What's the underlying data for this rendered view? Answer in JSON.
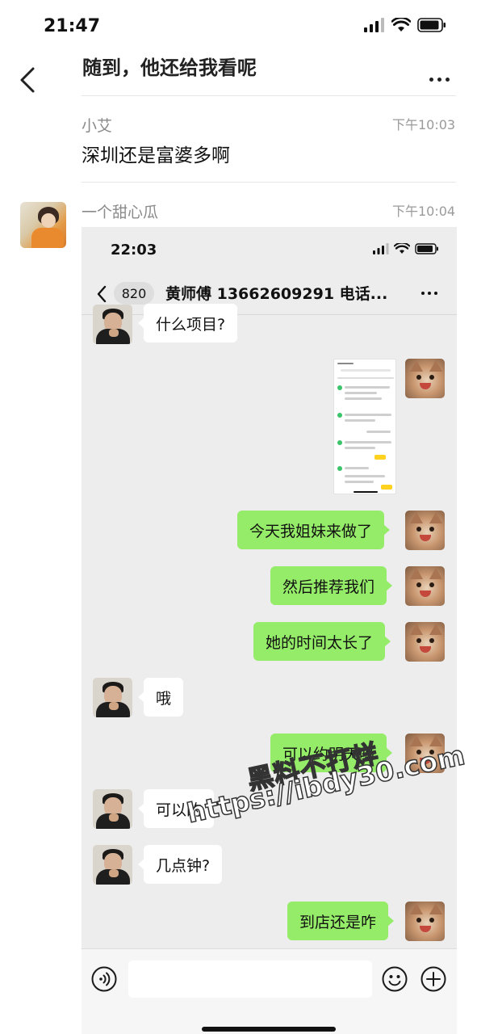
{
  "status_bar": {
    "time": "21:47"
  },
  "header": {
    "title": "随到，他还给我看呢"
  },
  "messages": [
    {
      "sender": "小艾",
      "time": "下午10:03",
      "text": "深圳还是富婆多啊"
    },
    {
      "sender": "一个甜心瓜",
      "time": "下午10:04"
    }
  ],
  "screenshot": {
    "status_time": "22:03",
    "unread_count": "820",
    "chat_title": "黄师傅 13662609291 电话...",
    "bubbles": [
      {
        "side": "in",
        "text": "什么项目?"
      },
      {
        "side": "out",
        "text": "今天我姐妹来做了"
      },
      {
        "side": "out",
        "text": "然后推荐我们"
      },
      {
        "side": "out",
        "text": "她的时间太长了"
      },
      {
        "side": "in",
        "text": "哦"
      },
      {
        "side": "out",
        "text": "可以约明天吗"
      },
      {
        "side": "in",
        "text": "可以的"
      },
      {
        "side": "in",
        "text": "几点钟?"
      },
      {
        "side": "out",
        "text": "到店还是咋"
      }
    ]
  },
  "watermark": {
    "line1": "黑料不打烊",
    "line2": "https://ibdy30.com"
  },
  "icons": [
    "back-chevron-icon",
    "more-icon",
    "signal-icon",
    "wifi-icon",
    "battery-icon",
    "voice-icon",
    "emoji-icon",
    "plus-icon"
  ]
}
